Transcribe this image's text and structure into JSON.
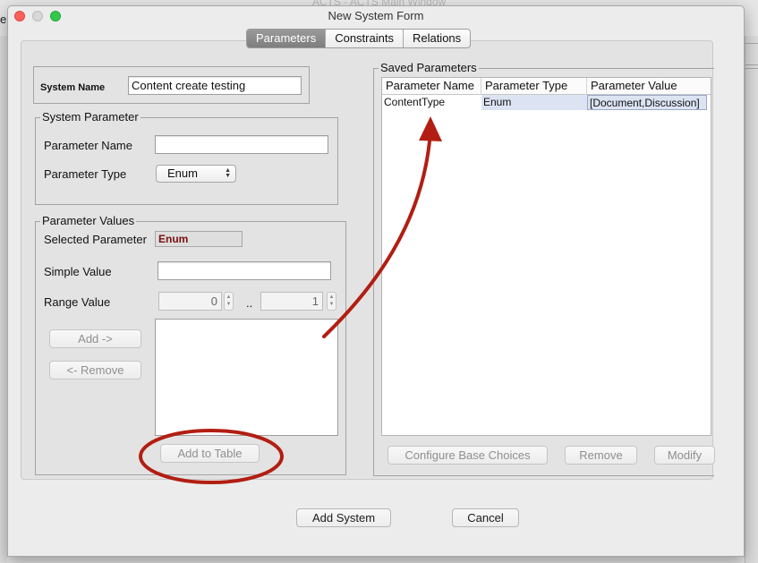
{
  "background_window": {
    "title": "ACTS - ACTS Main Window",
    "edge_letter": "e"
  },
  "dialog": {
    "title": "New System Form"
  },
  "tabs": [
    {
      "label": "Parameters",
      "active": true
    },
    {
      "label": "Constraints",
      "active": false
    },
    {
      "label": "Relations",
      "active": false
    }
  ],
  "system": {
    "name_label": "System Name",
    "name_value": "Content create testing"
  },
  "system_parameter": {
    "group_title": "System Parameter",
    "name_label": "Parameter Name",
    "name_value": "",
    "type_label": "Parameter Type",
    "type_value": "Enum"
  },
  "parameter_values": {
    "group_title": "Parameter Values",
    "selected_label": "Selected Parameter",
    "selected_value": "Enum",
    "simple_label": "Simple Value",
    "simple_value": "",
    "range_label": "Range Value",
    "range_from": "0",
    "range_sep": "..",
    "range_to": "1",
    "add_button": "Add ->",
    "remove_button": "<- Remove",
    "add_to_table_button": "Add to Table"
  },
  "saved_parameters": {
    "group_title": "Saved Parameters",
    "columns": [
      "Parameter Name",
      "Parameter Type",
      "Parameter Value"
    ],
    "rows": [
      [
        "ContentType",
        "Enum",
        "[Document,Discussion]"
      ]
    ],
    "configure_button": "Configure Base Choices",
    "remove_button": "Remove",
    "modify_button": "Modify"
  },
  "footer": {
    "add_system_button": "Add System",
    "cancel_button": "Cancel"
  },
  "colors": {
    "annotation": "#b21e12",
    "selected_param_text": "#7b0f0f",
    "row_highlight": "#dce4f3"
  }
}
